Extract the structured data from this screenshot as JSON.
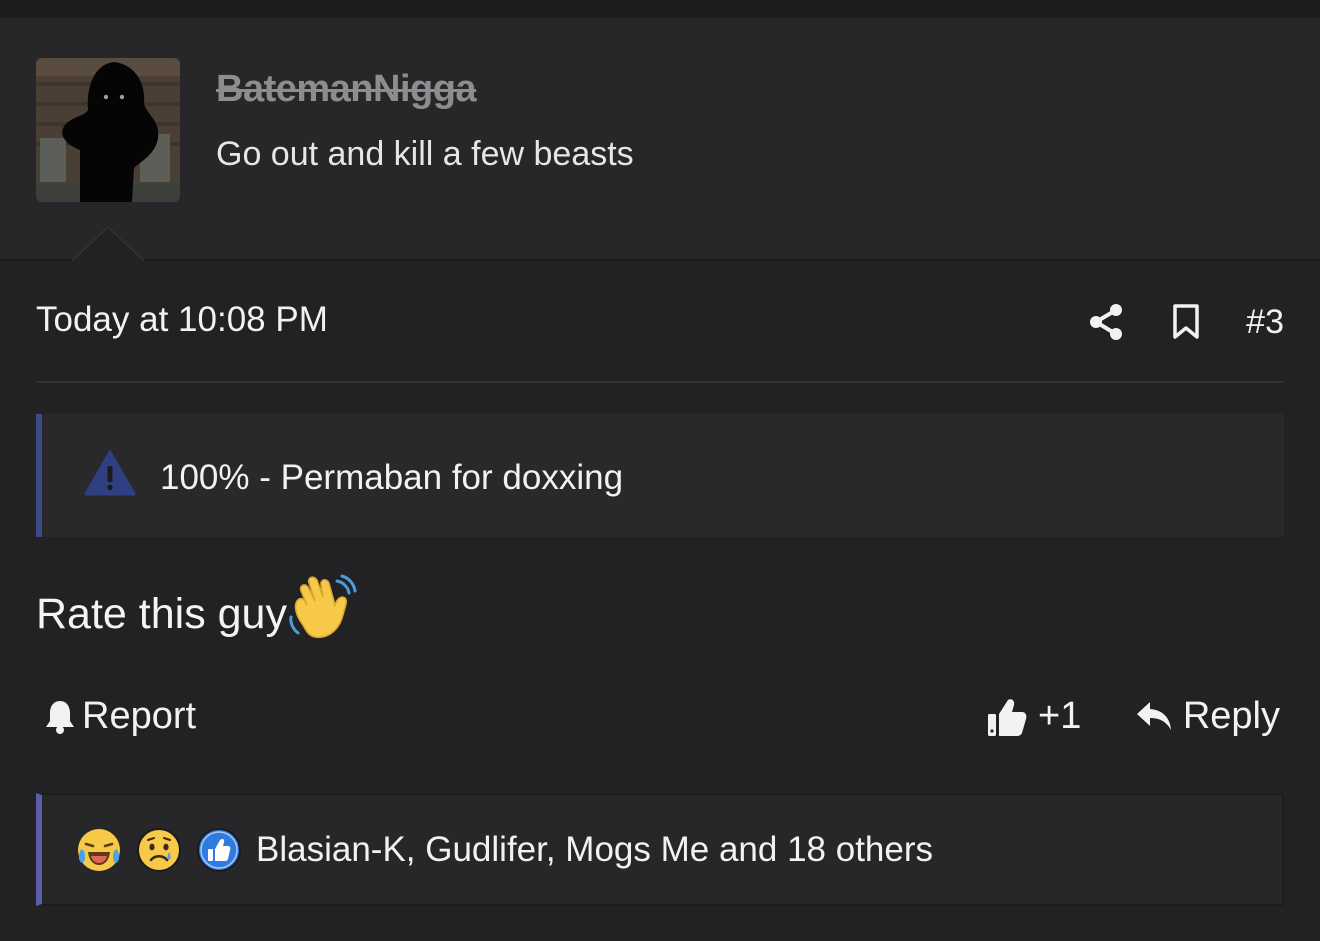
{
  "user": {
    "username": "BatemanNigga",
    "title": "Go out and kill a few beasts",
    "avatar_icon": "hooded-figure-avatar"
  },
  "post": {
    "timestamp": "Today at 10:08 PM",
    "number": "#3",
    "warning_text": "100% - Permaban for doxxing",
    "body_text": "Rate this guy",
    "body_emoji": "waving-hand-emoji"
  },
  "actions": {
    "report_label": "Report",
    "like_label": "+1",
    "reply_label": "Reply"
  },
  "reactions": {
    "icons": [
      "laughing-crying-emoji",
      "sad-emoji",
      "thumbs-up-reaction"
    ],
    "summary": "Blasian-K, Gudlifer, Mogs Me and 18 others"
  },
  "colors": {
    "background": "#222224",
    "warning_accent": "#3a4a8a",
    "reactions_accent": "#5a5fa8",
    "like_blue": "#2f7be0"
  }
}
